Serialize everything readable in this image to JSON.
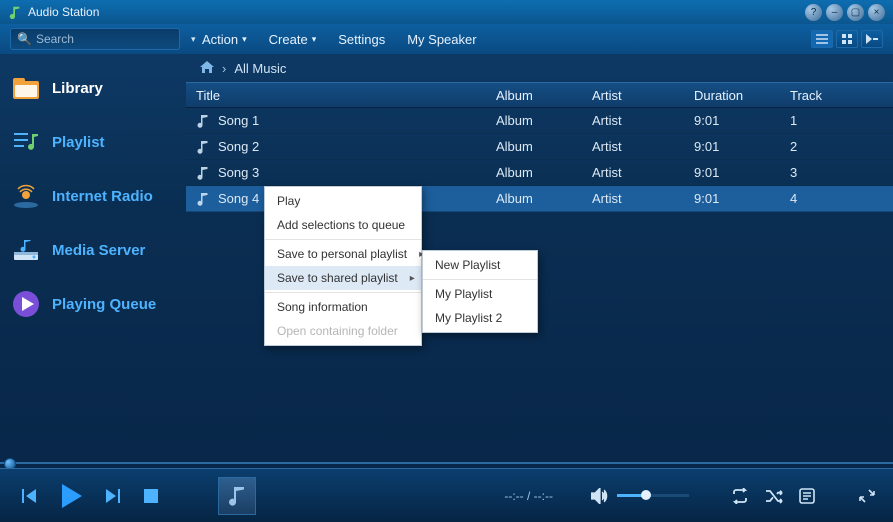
{
  "app": {
    "title": "Audio Station"
  },
  "toolbar": {
    "search_placeholder": "Search",
    "action": "Action",
    "create": "Create",
    "settings": "Settings",
    "speaker": "My Speaker"
  },
  "sidebar": {
    "items": [
      {
        "label": "Library"
      },
      {
        "label": "Playlist"
      },
      {
        "label": "Internet Radio"
      },
      {
        "label": "Media Server"
      },
      {
        "label": "Playing Queue"
      }
    ]
  },
  "breadcrumb": {
    "current": "All Music"
  },
  "table": {
    "headers": {
      "title": "Title",
      "album": "Album",
      "artist": "Artist",
      "duration": "Duration",
      "track": "Track"
    },
    "rows": [
      {
        "title": "Song 1",
        "album": "Album",
        "artist": "Artist",
        "duration": "9:01",
        "track": "1"
      },
      {
        "title": "Song 2",
        "album": "Album",
        "artist": "Artist",
        "duration": "9:01",
        "track": "2"
      },
      {
        "title": "Song 3",
        "album": "Album",
        "artist": "Artist",
        "duration": "9:01",
        "track": "3"
      },
      {
        "title": "Song 4",
        "album": "Album",
        "artist": "Artist",
        "duration": "9:01",
        "track": "4"
      }
    ]
  },
  "ctx_main": {
    "play": "Play",
    "add_queue": "Add selections to queue",
    "save_personal": "Save to personal playlist",
    "save_shared": "Save to shared playlist",
    "song_info": "Song information",
    "open_folder": "Open containing folder"
  },
  "ctx_sub": {
    "new_playlist": "New Playlist",
    "pl1": "My Playlist",
    "pl2": "My Playlist 2"
  },
  "player": {
    "time": "--:-- / --:--"
  }
}
